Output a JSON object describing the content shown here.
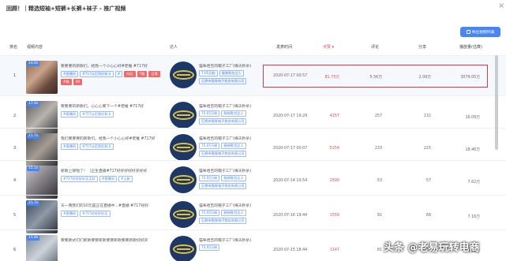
{
  "title": "回顾！｜精选短袖+短裤+长裤+袜子 - 推广视频",
  "close_glyph": "×",
  "export_label": "导出视频列表",
  "columns": {
    "rank": "排名",
    "video": "视频内容",
    "author": "达人",
    "time": "发表时间",
    "likes": "点赞",
    "comments": "评论",
    "shares": "分享",
    "plays": "播放量(估算)"
  },
  "rows": [
    {
      "rank": "1",
      "duration": "14.6s",
      "desc": "要要要的新款们。给我一个小心心好#老推 #717好",
      "tags": [
        "#直播间",
        "#717以后到好机卡",
        "#",
        "口红",
        "T恤",
        "日常",
        "#鞋",
        "99"
      ],
      "author": "猫咪哈吉的帽子工厂(梅天秒杀)",
      "author_badges": [
        "7.05万粉",
        "服装鞋包达人",
        "石狮市猫咪电子商务有限公司"
      ],
      "time": "2020-07-17 00:57",
      "likes": "81.73万",
      "comments": "5.56万",
      "shares": "2.09万",
      "plays": "3079.05万"
    },
    {
      "rank": "2",
      "duration": "17.6s",
      "desc": "要要要的新款们。心心心要下一个#老推 #717好",
      "tags": [
        "#直播间",
        "#717以后到好机卡"
      ],
      "author": "猫咪哈吉的帽子工厂(梅天秒杀)",
      "author_badges": [
        "75.05万粉",
        "服装鞋包达人",
        "石狮市猫咪电子商务有限公司"
      ],
      "time": "2020-07-17 19:29",
      "likes": "4257",
      "comments": "257",
      "shares": "132",
      "plays": "16.09万"
    },
    {
      "rank": "3",
      "duration": "11.7s",
      "desc": "我们要要要的新款们。给我一个小心心好#老推 #717好",
      "tags": [
        "#直播间",
        "#717以后到好机卡"
      ],
      "author": "猫咪哈吉的帽子工厂(梅天秒杀)",
      "author_badges": [
        "75.05万粉",
        "服装鞋包达人",
        "石狮市猫咪电子商务有限公司"
      ],
      "time": "2020-07-17 00:07",
      "likes": "5254",
      "comments": "233",
      "shares": "225",
      "plays": "18.46万"
    },
    {
      "rank": "4",
      "duration": "15.1s",
      "desc": "新款上架啦了！（正生直播#717好好好好好买好好",
      "tags": [
        "#717好好好好买买好",
        "#直播间",
        "#上新"
      ],
      "author": "猫咪哈吉的帽子工厂(梅天秒杀)",
      "author_badges": [
        "75.05万粉",
        "服装鞋包达人",
        "石狮市猫咪电子商务有限公司"
      ],
      "time": "2020-07-14 10:54",
      "likes": "2500",
      "comments": "53",
      "shares": "57",
      "plays": "7.62万"
    },
    {
      "rank": "5",
      "duration": "21.7s",
      "desc": "天一两我们的10元是正在直播中...#直播 #717好好",
      "tags": [
        "#直播间",
        "#717好好好好买"
      ],
      "author": "猫咪哈吉的帽子工厂(梅天秒杀)",
      "author_badges": [
        "75.05万粉",
        "服装鞋包达人",
        "石狮市猫咪电子商务有限公司"
      ],
      "time": "2020-07-16 19:44",
      "likes": "1559",
      "comments": "91",
      "shares": "68",
      "plays": "7.16万"
    },
    {
      "rank": "6",
      "duration": "15.8s",
      "desc": "要要款式们们新款要要新款要要新款要要新款好好买",
      "tags": [],
      "author": "猫咪哈吉的帽子工厂(梅天秒杀)",
      "author_badges": [
        "75.05万粉"
      ],
      "time": "2020-07-15 18:44",
      "likes": "1147",
      "comments": "81",
      "shares": "55",
      "plays": "4.62万"
    }
  ],
  "watermark": "头条 @老易玩转电商",
  "colors": {
    "accent": "#4a86f3",
    "likes": "#e24b4b",
    "highlight_box": "#e03b3b",
    "avatar_bg": "#1d3766",
    "avatar_emblem": "#e2c23a"
  }
}
